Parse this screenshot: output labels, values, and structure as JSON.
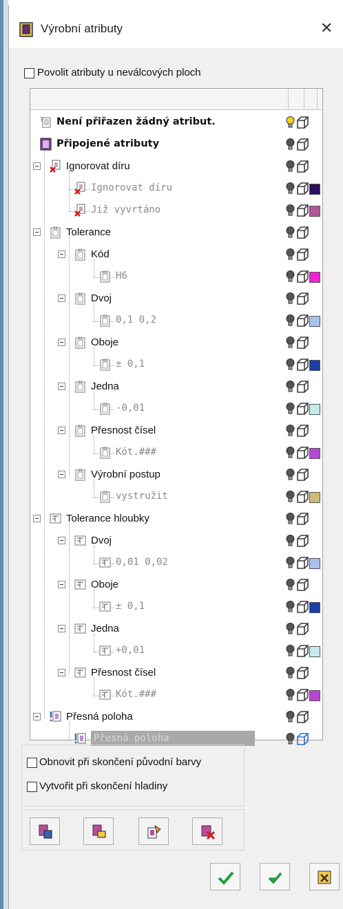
{
  "window": {
    "title": "Výrobní atributy"
  },
  "options": {
    "allow_noncylindrical": "Povolit atributy u neválcových ploch",
    "restore_colors": "Obnovit při skončení původní barvy",
    "create_layers": "Vytvořit při skončení hladiny"
  },
  "tree": {
    "rows": [
      {
        "label": "Není přiřazen žádný atribut.",
        "style": "bold",
        "icon": "unassigned-attribute-icon",
        "bulb": "#e9d51f",
        "swatch": null
      },
      {
        "label": "Připojené atributy",
        "style": "bold",
        "icon": "attached-attributes-icon",
        "bulb": "#555555",
        "swatch": null
      },
      {
        "label": "Ignorovat díru",
        "style": "normal",
        "icon": "ignore-hole-icon",
        "bulb": "#555555",
        "swatch": null
      },
      {
        "label": "Ignorovat díru",
        "style": "grey",
        "icon": "ignore-hole-icon",
        "bulb": "#555555",
        "swatch": "#2a0f5e"
      },
      {
        "label": "Již vyvrtáno",
        "style": "grey",
        "icon": "ignore-hole-icon",
        "bulb": "#555555",
        "swatch": "#b5559b"
      },
      {
        "label": "Tolerance",
        "style": "normal",
        "icon": "tolerance-icon",
        "bulb": "#555555",
        "swatch": null
      },
      {
        "label": "Kód",
        "style": "normal",
        "icon": "tolerance-icon",
        "bulb": "#555555",
        "swatch": null
      },
      {
        "label": "H6",
        "style": "grey",
        "icon": "tolerance-icon",
        "bulb": "#555555",
        "swatch": "#ee22d4"
      },
      {
        "label": "Dvoj",
        "style": "normal",
        "icon": "tolerance-icon",
        "bulb": "#555555",
        "swatch": null
      },
      {
        "label": "0,1      0,2",
        "style": "grey",
        "icon": "tolerance-icon",
        "bulb": "#555555",
        "swatch": "#a8c2ec"
      },
      {
        "label": "Oboje",
        "style": "normal",
        "icon": "tolerance-icon",
        "bulb": "#555555",
        "swatch": null
      },
      {
        "label": "± 0,1",
        "style": "grey",
        "icon": "tolerance-icon",
        "bulb": "#555555",
        "swatch": "#1a3fa8"
      },
      {
        "label": "Jedna",
        "style": "normal",
        "icon": "tolerance-icon",
        "bulb": "#555555",
        "swatch": null
      },
      {
        "label": "-0,01",
        "style": "grey",
        "icon": "tolerance-icon",
        "bulb": "#555555",
        "swatch": "#c4ecec"
      },
      {
        "label": "Přesnost čísel",
        "style": "normal",
        "icon": "tolerance-icon",
        "bulb": "#555555",
        "swatch": null
      },
      {
        "label": "Kót.###",
        "style": "grey",
        "icon": "tolerance-icon",
        "bulb": "#555555",
        "swatch": "#b646d6"
      },
      {
        "label": "Výrobní postup",
        "style": "normal",
        "icon": "tolerance-icon",
        "bulb": "#555555",
        "swatch": null
      },
      {
        "label": "vystružit",
        "style": "grey",
        "icon": "tolerance-icon",
        "bulb": "#555555",
        "swatch": "#cdbb7a"
      },
      {
        "label": "Tolerance hloubky",
        "style": "normal",
        "icon": "depth-tolerance-icon",
        "bulb": "#555555",
        "swatch": null
      },
      {
        "label": "Dvoj",
        "style": "normal",
        "icon": "depth-tolerance-icon",
        "bulb": "#555555",
        "swatch": null
      },
      {
        "label": "0,01      0,02",
        "style": "grey",
        "icon": "depth-tolerance-icon",
        "bulb": "#555555",
        "swatch": "#a8c2ec"
      },
      {
        "label": "Oboje",
        "style": "normal",
        "icon": "depth-tolerance-icon",
        "bulb": "#555555",
        "swatch": null
      },
      {
        "label": "± 0,1",
        "style": "grey",
        "icon": "depth-tolerance-icon",
        "bulb": "#555555",
        "swatch": "#1a3fa8"
      },
      {
        "label": "Jedna",
        "style": "normal",
        "icon": "depth-tolerance-icon",
        "bulb": "#555555",
        "swatch": null
      },
      {
        "label": "+0,01",
        "style": "grey",
        "icon": "depth-tolerance-icon",
        "bulb": "#555555",
        "swatch": "#c4ecec"
      },
      {
        "label": "Přesnost čísel",
        "style": "normal",
        "icon": "depth-tolerance-icon",
        "bulb": "#555555",
        "swatch": null
      },
      {
        "label": "Kót.###",
        "style": "grey",
        "icon": "depth-tolerance-icon",
        "bulb": "#555555",
        "swatch": "#b646d6"
      },
      {
        "label": "Přesná poloha",
        "style": "normal",
        "icon": "exact-position-icon",
        "bulb": "#555555",
        "swatch": null
      },
      {
        "label": "Přesná poloha",
        "style": "selected",
        "icon": "exact-position-icon",
        "bulb": "#555555",
        "swatch": null
      }
    ]
  },
  "toolbar": {
    "buttons": [
      "add-attribute-icon",
      "edit-attribute-icon",
      "assign-attribute-icon",
      "delete-attribute-icon"
    ]
  },
  "footer": {
    "buttons": [
      "ok-checkmark-icon",
      "apply-icon",
      "cancel-icon"
    ]
  },
  "colors": {
    "selection": "#a9a9a9",
    "accent": "#2e6fc2"
  }
}
